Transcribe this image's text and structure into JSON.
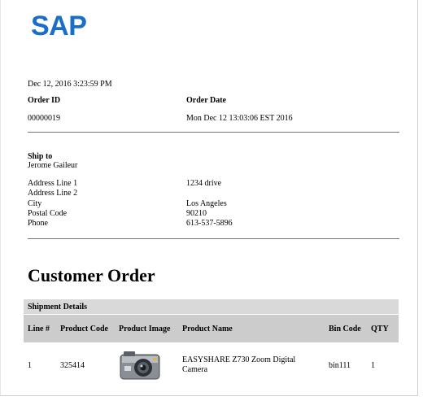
{
  "logo": "SAP",
  "timestamp": "Dec 12, 2016 3:23:59 PM",
  "order": {
    "id_label": "Order ID",
    "id_value": "00000019",
    "date_label": "Order Date",
    "date_value": "Mon Dec 12 13:03:06 EST 2016"
  },
  "ship_to": {
    "label": "Ship to",
    "name": "Jerome Gaileur",
    "fields": [
      {
        "label": "Address Line 1",
        "value": "1234 drive"
      },
      {
        "label": "Address Line 2",
        "value": ""
      },
      {
        "label": "City",
        "value": "Los Angeles"
      },
      {
        "label": "Postal Code",
        "value": "90210"
      },
      {
        "label": "Phone",
        "value": "613-537-5896"
      }
    ]
  },
  "section_title": "Customer Order",
  "shipment": {
    "title": "Shipment Details",
    "columns": [
      "Line #",
      "Product Code",
      "Product Image",
      "Product Name",
      "Bin Code",
      "QTY"
    ],
    "rows": [
      {
        "line": "1",
        "code": "325414",
        "image_icon": "camera-image",
        "name": "EASYSHARE Z730 Zoom Digital Camera",
        "bin": "bin111",
        "qty": "1"
      }
    ]
  }
}
